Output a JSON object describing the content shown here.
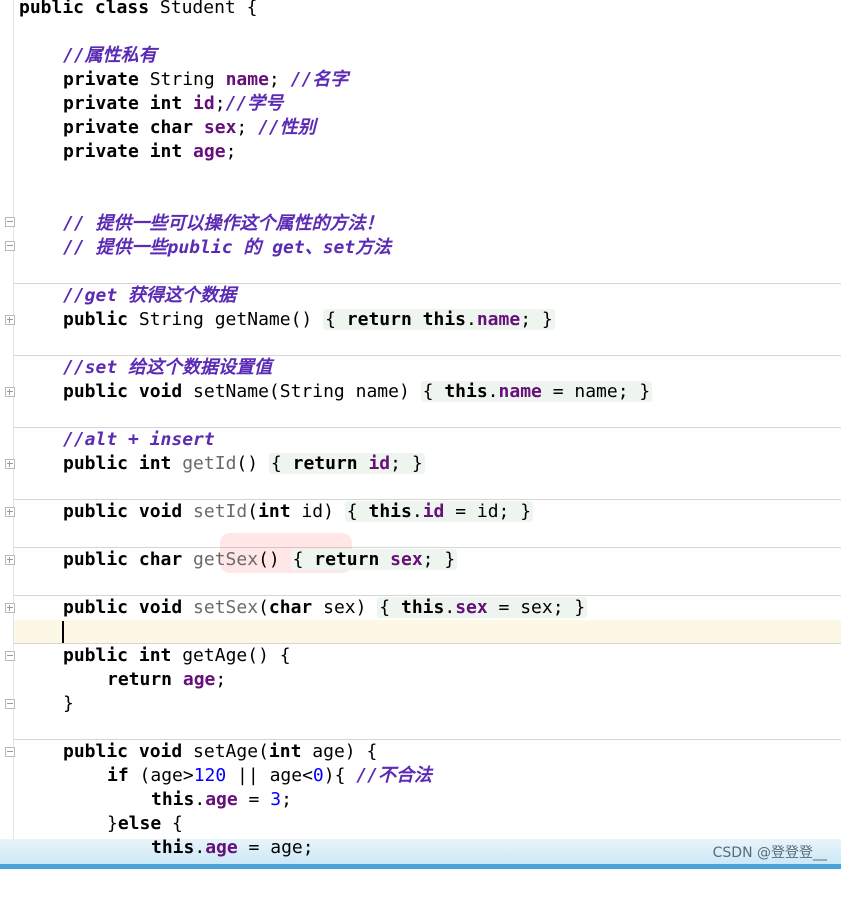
{
  "editor": {
    "class_decl": "public class Student {",
    "comments": {
      "attrs_private": "//属性私有",
      "name": "//名字",
      "id": "//学号",
      "sex": "//性别",
      "methods1": "// 提供一些可以操作这个属性的方法！",
      "methods2": "// 提供一些public 的 get、set方法",
      "get": "//get 获得这个数据",
      "set": "//set 给这个数据设置值",
      "alt": "//alt + insert",
      "illegal": "//不合法"
    },
    "fields": [
      {
        "mod": "private",
        "type": "String",
        "name": "name"
      },
      {
        "mod": "private",
        "type": "int",
        "name": "id"
      },
      {
        "mod": "private",
        "type": "char",
        "name": "sex"
      },
      {
        "mod": "private",
        "type": "int",
        "name": "age"
      }
    ],
    "methods": {
      "getName": {
        "sig": "public String getName()",
        "body": "return this.name;"
      },
      "setName": {
        "sig": "public void setName(String name)",
        "body": "this.name = name;"
      },
      "getId": {
        "sig": "public int getId()",
        "body": "return id;"
      },
      "setId": {
        "sig": "public void setId(int id)",
        "body": "this.id = id;"
      },
      "getSex": {
        "sig": "public char getSex()",
        "body": "return sex;"
      },
      "setSex": {
        "sig": "public void setSex(char sex)",
        "body": "this.sex = sex;"
      },
      "getAge": {
        "sig": "public int getAge() {",
        "body": "return age;",
        "close": "}"
      },
      "setAge": {
        "sig": "public void setAge(int age) {",
        "if_line": "if (age>120 || age<0){",
        "assign3": "this.age = 3;",
        "else_line": "}else {",
        "assign": "this.age = age;"
      }
    }
  },
  "watermark_text": "CSDN @登登登__"
}
